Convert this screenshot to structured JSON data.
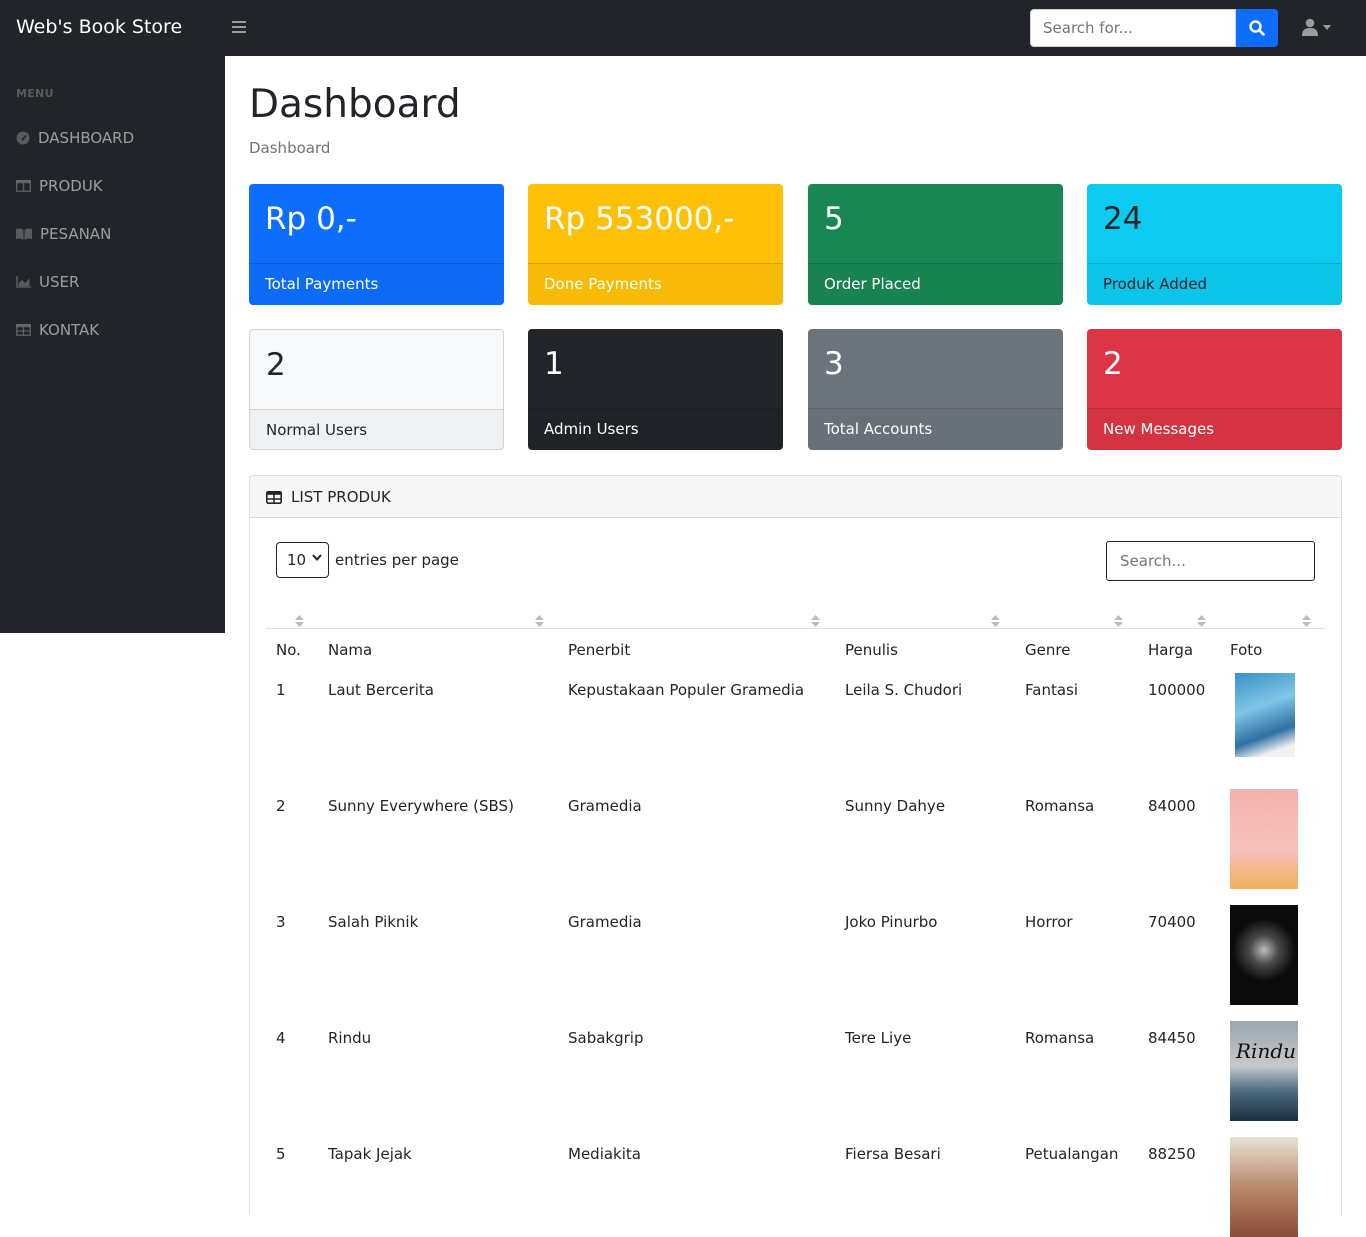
{
  "app": {
    "brand": "Web's Book Store"
  },
  "topbar": {
    "search_placeholder": "Search for..."
  },
  "sidebar": {
    "heading": "MENU",
    "items": [
      {
        "label": "DASHBOARD",
        "icon": "dashboard-icon"
      },
      {
        "label": "PRODUK",
        "icon": "columns-icon"
      },
      {
        "label": "PESANAN",
        "icon": "book-open-icon"
      },
      {
        "label": "USER",
        "icon": "area-chart-icon"
      },
      {
        "label": "KONTAK",
        "icon": "table-icon"
      }
    ]
  },
  "page": {
    "title": "Dashboard",
    "breadcrumb": "Dashboard"
  },
  "stats": [
    {
      "value": "Rp 0,-",
      "label": "Total Payments",
      "bg": "#0d6efd",
      "color": "#ffffff"
    },
    {
      "value": "Rp 553000,-",
      "label": "Done Payments",
      "bg": "#ffc107",
      "color": "#ffffff"
    },
    {
      "value": "5",
      "label": "Order Placed",
      "bg": "#198754",
      "color": "#ffffff"
    },
    {
      "value": "24",
      "label": "Produk Added",
      "bg": "#0dcaf0",
      "color": "#212529"
    },
    {
      "value": "2",
      "label": "Normal Users",
      "bg": "#f8f9fa",
      "color": "#212529"
    },
    {
      "value": "1",
      "label": "Admin Users",
      "bg": "#212529",
      "color": "#ffffff"
    },
    {
      "value": "3",
      "label": "Total Accounts",
      "bg": "#6c757d",
      "color": "#ffffff"
    },
    {
      "value": "2",
      "label": "New Messages",
      "bg": "#dc3545",
      "color": "#ffffff"
    }
  ],
  "produk_table": {
    "title": "LIST PRODUK",
    "entries_value": "10",
    "entries_label": "entries per page",
    "search_placeholder": "Search...",
    "columns": [
      "No.",
      "Nama",
      "Penerbit",
      "Penulis",
      "Genre",
      "Harga",
      "Foto"
    ],
    "rows": [
      {
        "no": "1",
        "nama": "Laut Bercerita",
        "penerbit": "Kepustakaan Populer Gramedia",
        "penulis": "Leila S. Chudori",
        "genre": "Fantasi",
        "harga": "100000",
        "cover_text": ""
      },
      {
        "no": "2",
        "nama": "Sunny Everywhere (SBS)",
        "penerbit": "Gramedia",
        "penulis": "Sunny Dahye",
        "genre": "Romansa",
        "harga": "84000",
        "cover_text": ""
      },
      {
        "no": "3",
        "nama": "Salah Piknik",
        "penerbit": "Gramedia",
        "penulis": "Joko Pinurbo",
        "genre": "Horror",
        "harga": "70400",
        "cover_text": ""
      },
      {
        "no": "4",
        "nama": "Rindu",
        "penerbit": "Sabakgrip",
        "penulis": "Tere Liye",
        "genre": "Romansa",
        "harga": "84450",
        "cover_text": "Rindu"
      },
      {
        "no": "5",
        "nama": "Tapak Jejak",
        "penerbit": "Mediakita",
        "penulis": "Fiersa Besari",
        "genre": "Petualangan",
        "harga": "88250",
        "cover_text": ""
      }
    ]
  }
}
